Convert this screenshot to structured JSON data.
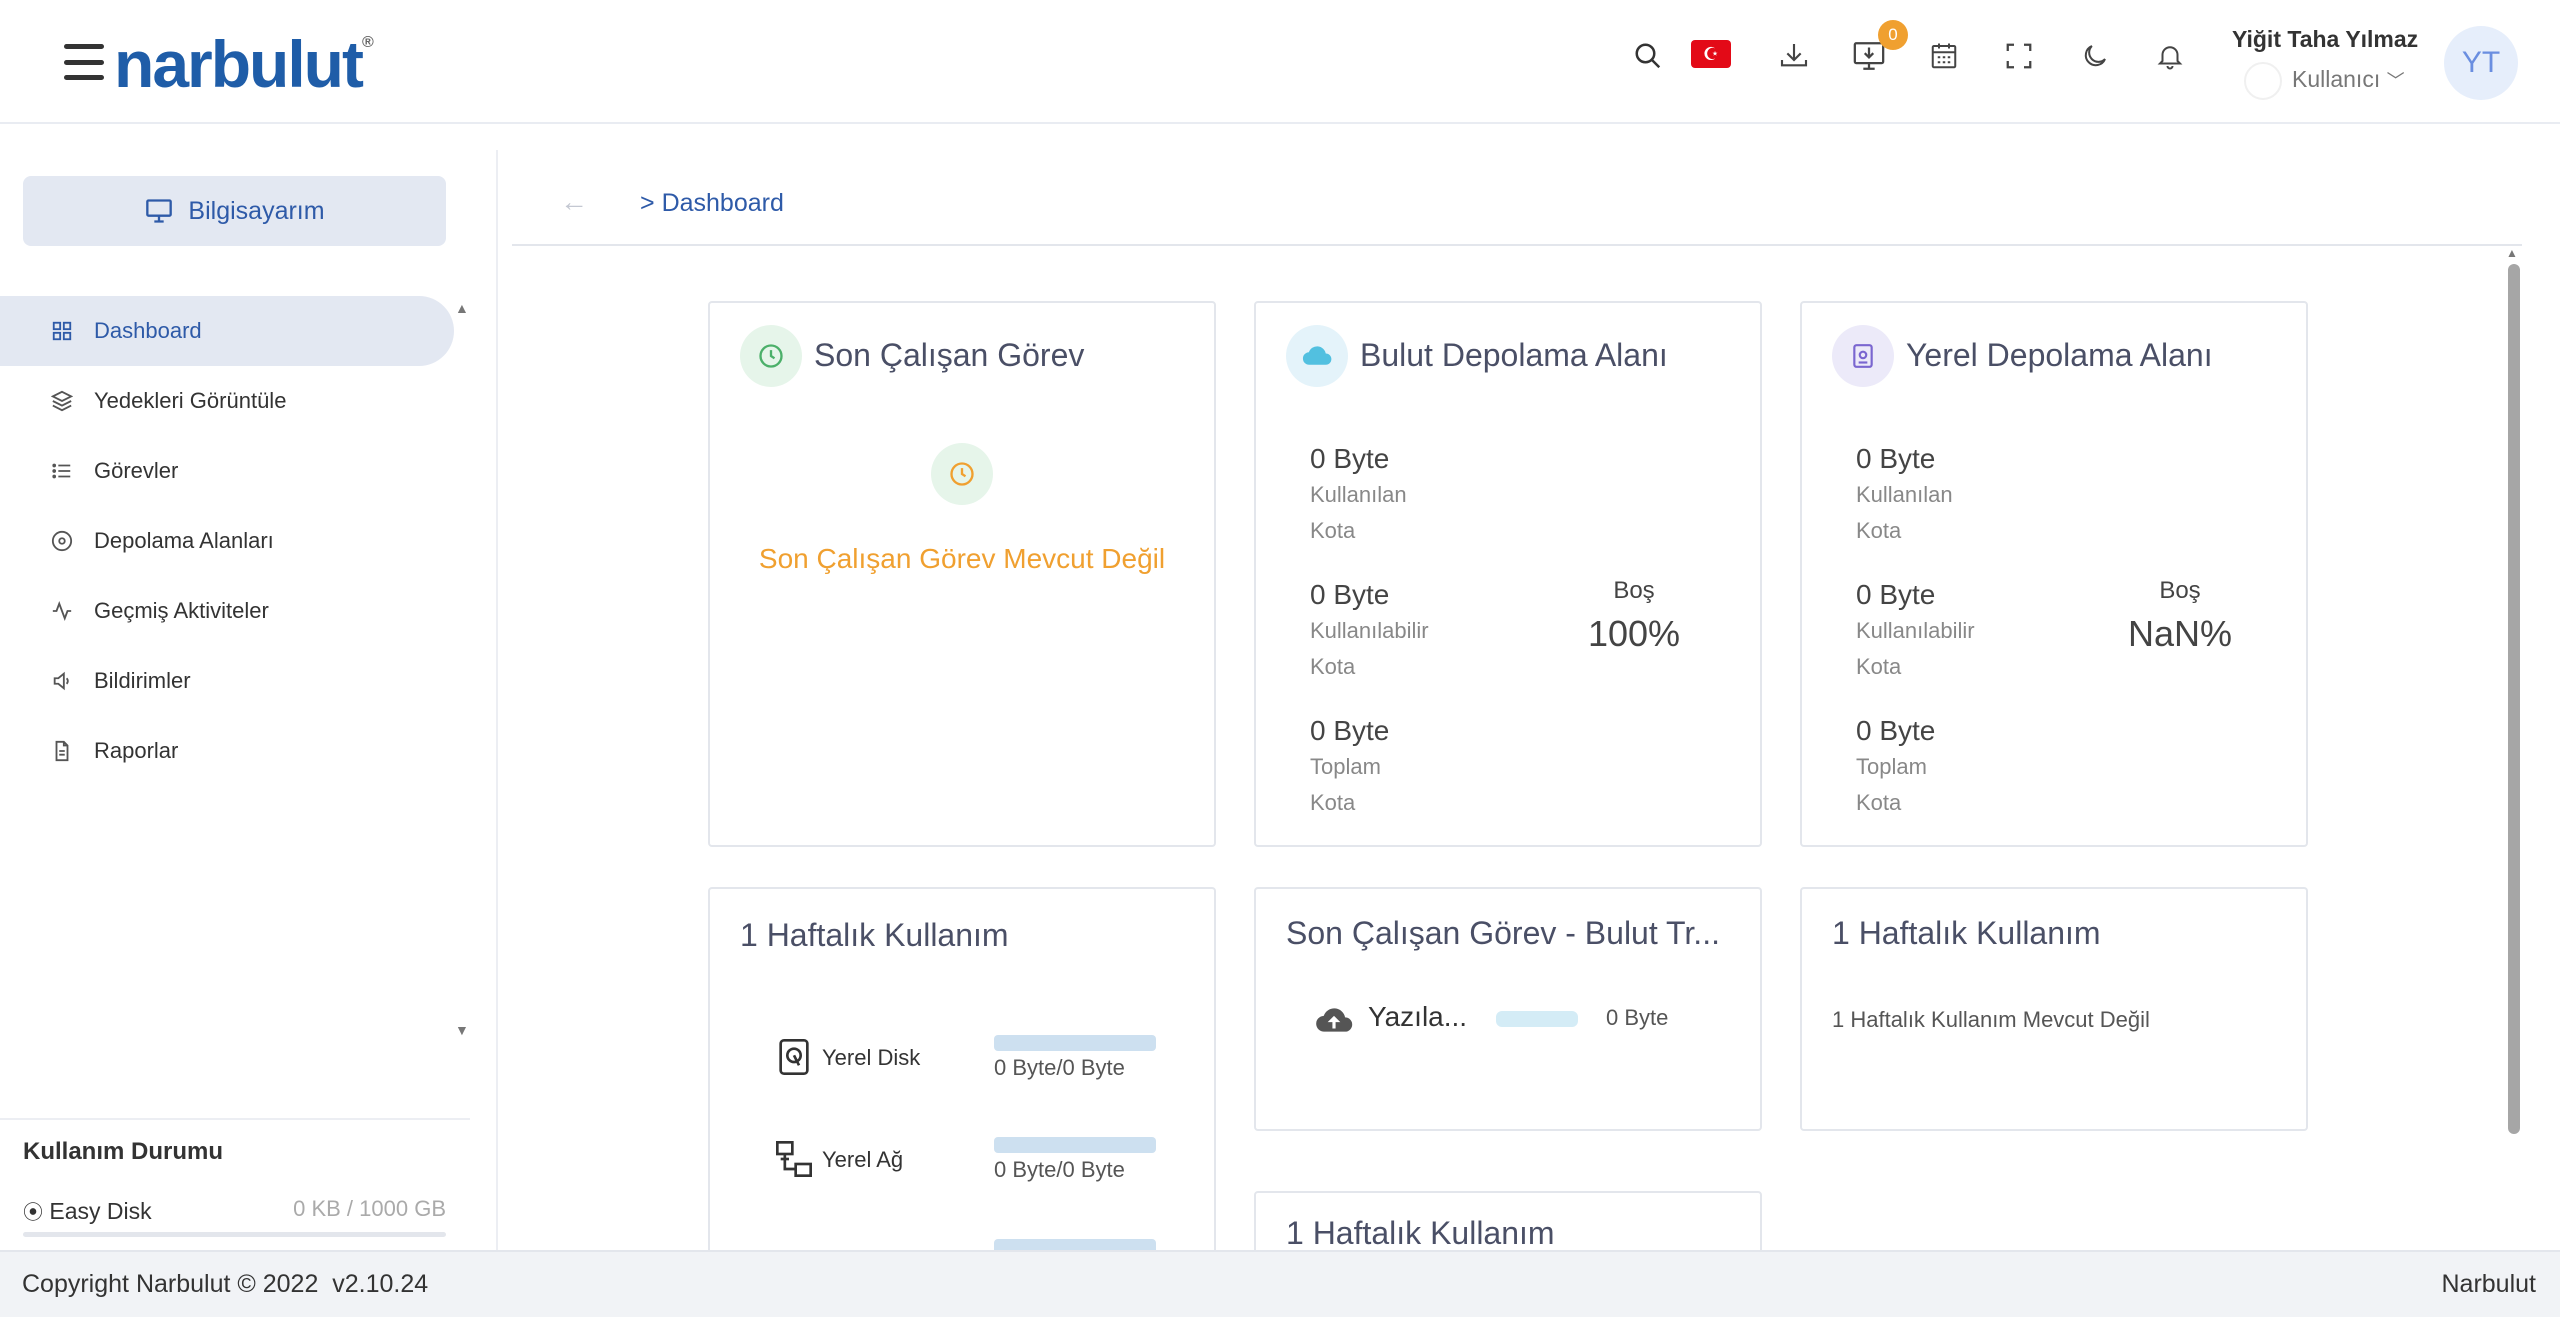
{
  "header": {
    "logo_text": "narbulut",
    "logo_reg": "®",
    "notifications_badge": "0",
    "flag_symbol": "☪",
    "user_name": "Yiğit Taha Yılmaz",
    "user_role": "Kullanıcı",
    "avatar_initials": "YT"
  },
  "sidebar": {
    "computer_button": "Bilgisayarım",
    "items": [
      {
        "label": "Dashboard",
        "icon": "grid-icon"
      },
      {
        "label": "Yedekleri Görüntüle",
        "icon": "layers-icon"
      },
      {
        "label": "Görevler",
        "icon": "list-icon"
      },
      {
        "label": "Depolama Alanları",
        "icon": "disc-icon"
      },
      {
        "label": "Geçmiş Aktiviteler",
        "icon": "activity-icon"
      },
      {
        "label": "Bildirimler",
        "icon": "speaker-icon"
      },
      {
        "label": "Raporlar",
        "icon": "file-icon"
      }
    ],
    "usage": {
      "title": "Kullanım Durumu",
      "disk_name": "Easy Disk",
      "disk_value": "0 KB / 1000 GB"
    }
  },
  "breadcrumb": {
    "separator": ">",
    "current": "Dashboard"
  },
  "cards": {
    "last_task": {
      "title": "Son Çalışan Görev",
      "empty_message": "Son Çalışan Görev Mevcut Değil"
    },
    "cloud_storage": {
      "title": "Bulut Depolama Alanı",
      "used_value": "0 Byte",
      "used_label1": "Kullanılan",
      "used_label2": "Kota",
      "available_value": "0 Byte",
      "available_label1": "Kullanılabilir",
      "available_label2": "Kota",
      "total_value": "0 Byte",
      "total_label1": "Toplam",
      "total_label2": "Kota",
      "free_label": "Boş",
      "free_value": "100%"
    },
    "local_storage": {
      "title": "Yerel Depolama Alanı",
      "used_value": "0 Byte",
      "used_label1": "Kullanılan",
      "used_label2": "Kota",
      "available_value": "0 Byte",
      "available_label1": "Kullanılabilir",
      "available_label2": "Kota",
      "total_value": "0 Byte",
      "total_label1": "Toplam",
      "total_label2": "Kota",
      "free_label": "Boş",
      "free_value": "NaN%"
    },
    "weekly_usage_1": {
      "title": "1 Haftalık Kullanım",
      "rows": [
        {
          "label": "Yerel Disk",
          "value": "0 Byte/0 Byte"
        },
        {
          "label": "Yerel Ağ",
          "value": "0 Byte/0 Byte"
        }
      ]
    },
    "last_task_cloud": {
      "title": "Son Çalışan Görev - Bulut Tr...",
      "row_label": "Yazıla...",
      "row_value": "0 Byte"
    },
    "weekly_usage_2": {
      "title": "1 Haftalık Kullanım",
      "empty_message": "1 Haftalık Kullanım Mevcut Değil"
    },
    "weekly_usage_3": {
      "title": "1 Haftalık Kullanım"
    }
  },
  "footer": {
    "copyright": "Copyright Narbulut © 2022  v2.10.24",
    "brand": "Narbulut"
  },
  "colors": {
    "primary": "#2e5aa8",
    "accent_orange": "#f0a030",
    "active_bg": "#e3e8f2"
  }
}
